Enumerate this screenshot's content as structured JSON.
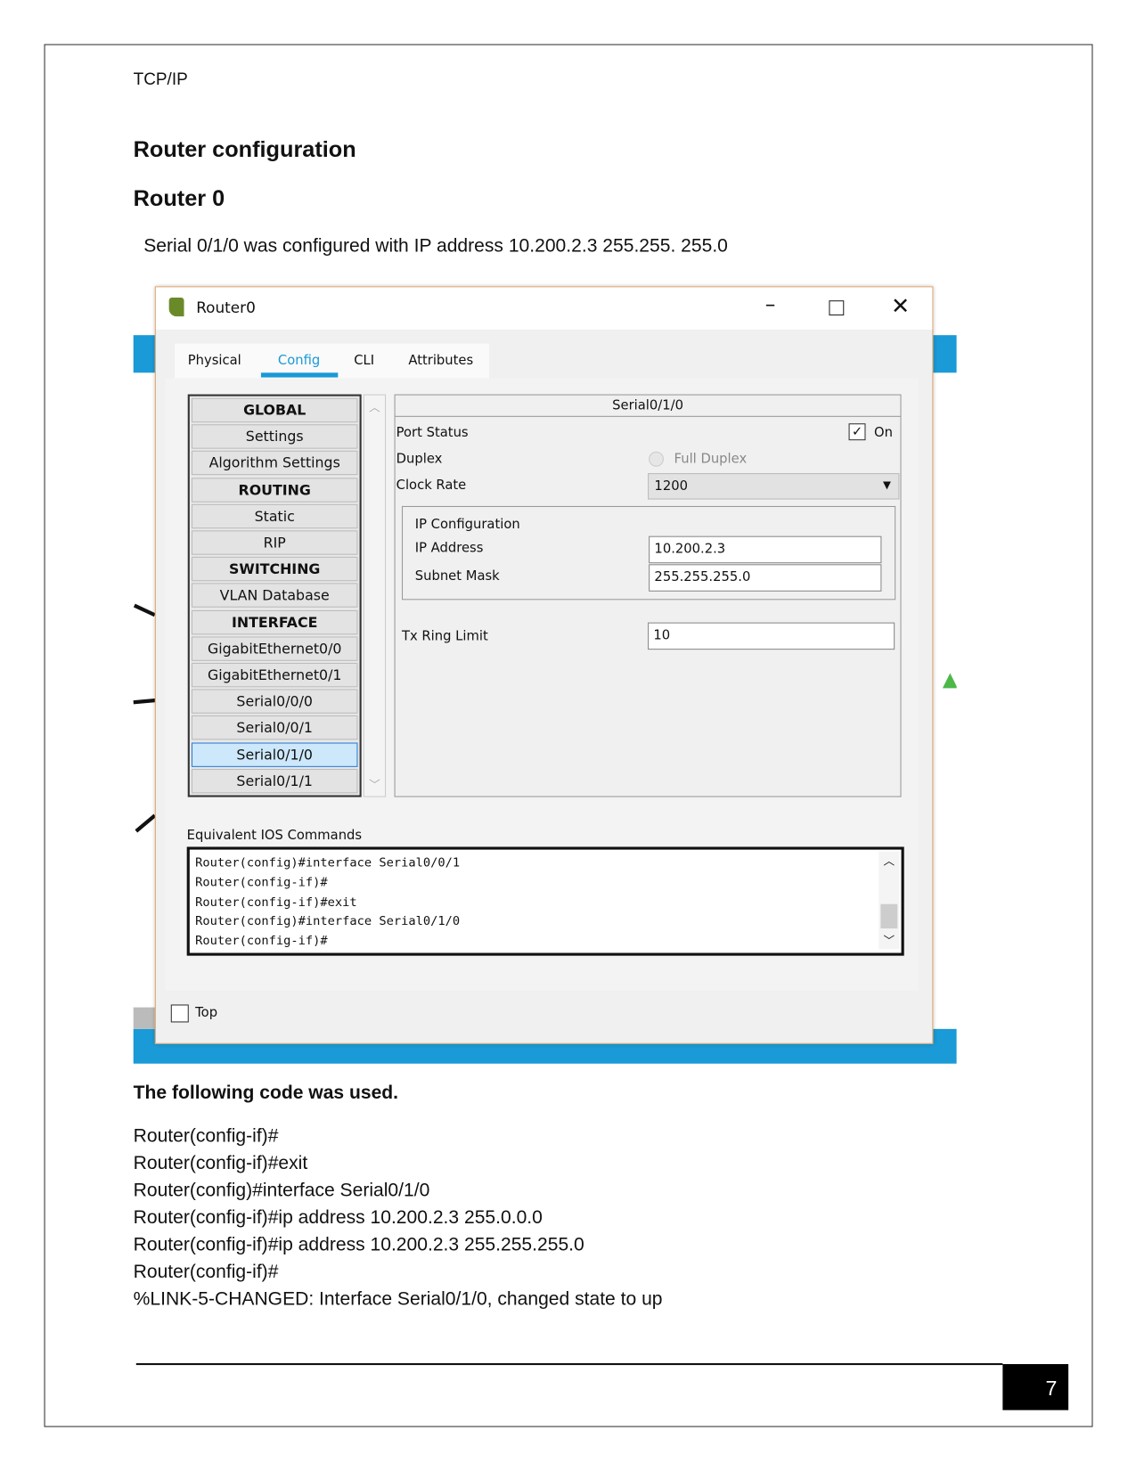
{
  "header": {
    "running_title": "TCP/IP"
  },
  "section_title": "Router configuration",
  "subsection_title": "Router 0",
  "intro": "Serial 0/1/0 was configured with IP address 10.200.2.3 255.255. 255.0",
  "window": {
    "title": "Router0",
    "tabs": [
      "Physical",
      "Config",
      "CLI",
      "Attributes"
    ],
    "active_tab": "Config",
    "accent": "#1a9ad6",
    "sidebar": [
      {
        "label": "GLOBAL",
        "header": true
      },
      {
        "label": "Settings"
      },
      {
        "label": "Algorithm Settings"
      },
      {
        "label": "ROUTING",
        "header": true
      },
      {
        "label": "Static"
      },
      {
        "label": "RIP"
      },
      {
        "label": "SWITCHING",
        "header": true
      },
      {
        "label": "VLAN Database"
      },
      {
        "label": "INTERFACE",
        "header": true
      },
      {
        "label": "GigabitEthernet0/0"
      },
      {
        "label": "GigabitEthernet0/1"
      },
      {
        "label": "Serial0/0/0"
      },
      {
        "label": "Serial0/0/1"
      },
      {
        "label": "Serial0/1/0",
        "selected": true
      },
      {
        "label": "Serial0/1/1"
      }
    ],
    "panel": {
      "title": "Serial0/1/0",
      "port_status_label": "Port Status",
      "port_on_label": "On",
      "port_on": true,
      "duplex_label": "Duplex",
      "duplex_value": "Full Duplex",
      "clock_rate_label": "Clock Rate",
      "clock_rate": "1200",
      "ip_config_label": "IP Configuration",
      "ip_address_label": "IP Address",
      "ip_address": "10.200.2.3",
      "subnet_mask_label": "Subnet Mask",
      "subnet_mask": "255.255.255.0",
      "tx_ring_label": "Tx Ring Limit",
      "tx_ring": "10"
    },
    "ios_label": "Equivalent IOS Commands",
    "ios_lines": [
      "Router(config)#interface Serial0/0/1",
      "Router(config-if)#",
      "Router(config-if)#exit",
      "Router(config)#interface Serial0/1/0",
      "Router(config-if)#"
    ],
    "top_label": "Top"
  },
  "code_heading": "The following code was used.",
  "code_lines": [
    "Router(config-if)#",
    "Router(config-if)#exit",
    "Router(config)#interface Serial0/1/0",
    "Router(config-if)#ip address 10.200.2.3 255.0.0.0",
    "Router(config-if)#ip address 10.200.2.3 255.255.255.0",
    "Router(config-if)#",
    "%LINK-5-CHANGED: Interface Serial0/1/0, changed state to up"
  ],
  "footer": {
    "page_number": "7"
  }
}
